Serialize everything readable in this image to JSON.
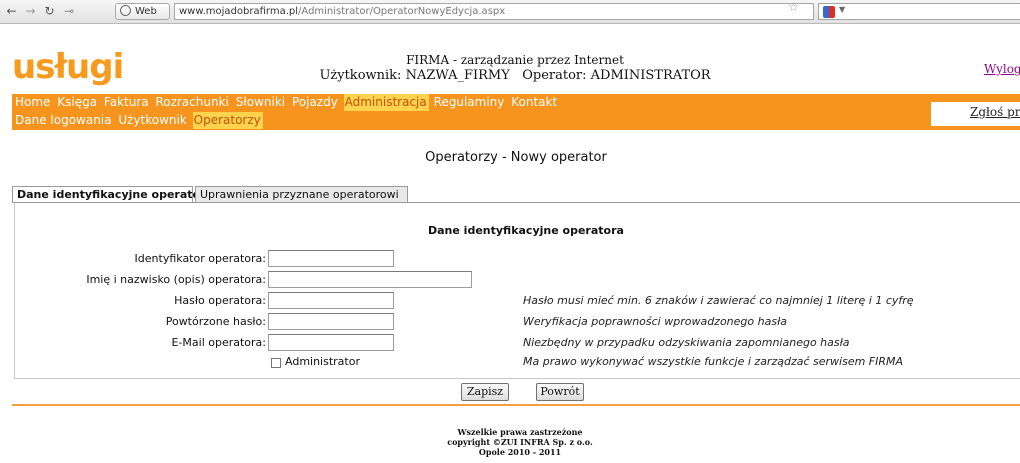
{
  "browser": {
    "tab_label": "Web",
    "url_domain": "www.mojadobrafirma.pl",
    "url_path": "/Administrator/OperatorNowyEdycja.aspx"
  },
  "header": {
    "logo": "usługi",
    "title": "FIRMA - zarządzanie przez Internet",
    "user_label": "Użytkownik: NAZWA_FIRMY",
    "operator_label": "Operator: ADMINISTRATOR",
    "logout": "Wylog"
  },
  "menu": {
    "main": [
      "Home",
      "Księga",
      "Faktura",
      "Rozrachunki",
      "Słowniki",
      "Pojazdy",
      "Administracja",
      "Regulaminy",
      "Kontakt"
    ],
    "sub": [
      "Dane logowania",
      "Użytkownik",
      "Operatorzy"
    ],
    "report": "Zgłoś proble"
  },
  "page_title": "Operatorzy - Nowy operator",
  "tabs": [
    "Dane identyfikacyjne operatora",
    "Uprawnienia przyznane operatorowi"
  ],
  "form": {
    "section_title": "Dane identyfikacyjne operatora",
    "fields": [
      {
        "label": "Identyfikator operatora:",
        "hint": ""
      },
      {
        "label": "Imię i nazwisko (opis) operatora:",
        "hint": ""
      },
      {
        "label": "Hasło operatora:",
        "hint": "Hasło musi mieć min. 6 znaków i zawierać co najmniej 1 literę i 1 cyfrę"
      },
      {
        "label": "Powtórzone hasło:",
        "hint": "Weryfikacja poprawności wprowadzonego hasła"
      },
      {
        "label": "E-Mail operatora:",
        "hint": "Niezbędny w przypadku odzyskiwania zapomnianego hasła"
      }
    ],
    "admin_checkbox": "Administrator",
    "admin_hint": "Ma prawo wykonywać wszystkie funkcje i zarządzać serwisem FIRMA",
    "save": "Zapisz",
    "back": "Powrót"
  },
  "footer": {
    "line1": "Wszelkie prawa zastrzeżone",
    "line2": "copyright ©ZUI INFRA Sp. z o.o.",
    "line3": "Opole 2010 - 2011"
  },
  "colors": {
    "accent": "#f7941d",
    "active_menu": "#ffd34e"
  }
}
